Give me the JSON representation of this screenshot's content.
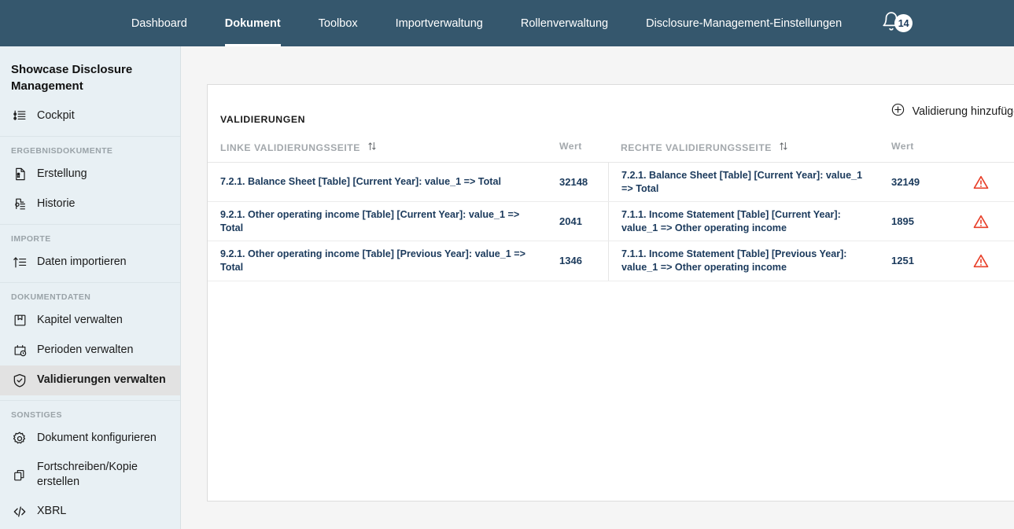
{
  "topnav": {
    "items": [
      {
        "label": "Dashboard",
        "active": false
      },
      {
        "label": "Dokument",
        "active": true
      },
      {
        "label": "Toolbox",
        "active": false
      },
      {
        "label": "Importverwaltung",
        "active": false
      },
      {
        "label": "Rollenverwaltung",
        "active": false
      },
      {
        "label": "Disclosure-Management-Einstellungen",
        "active": false
      }
    ],
    "notification_icon": "bell-icon",
    "notification_count": "14",
    "background_color": "#35576d"
  },
  "sidebar": {
    "brand": "Showcase Disclosure Management",
    "background_color": "#e8f0f4",
    "active_item_color": "#e2e2e2",
    "sections": [
      {
        "label": "",
        "items": [
          {
            "label": "Cockpit",
            "icon": "list-tree-icon",
            "active": false
          }
        ]
      },
      {
        "label": "ERGEBNISDOKUMENTE",
        "items": [
          {
            "label": "Erstellung",
            "icon": "document-badge-icon",
            "active": false
          },
          {
            "label": "Historie",
            "icon": "document-history-icon",
            "active": false
          }
        ]
      },
      {
        "label": "IMPORTE",
        "items": [
          {
            "label": "Daten importieren",
            "icon": "import-arrow-icon",
            "active": false
          }
        ]
      },
      {
        "label": "DOKUMENTDATEN",
        "items": [
          {
            "label": "Kapitel verwalten",
            "icon": "book-bookmark-icon",
            "active": false
          },
          {
            "label": "Perioden verwalten",
            "icon": "calendar-clock-icon",
            "active": false
          },
          {
            "label": "Validierungen verwalten",
            "icon": "shield-check-icon",
            "active": true
          }
        ]
      },
      {
        "label": "SONSTIGES",
        "items": [
          {
            "label": "Dokument konfigurieren",
            "icon": "gear-icon",
            "active": false
          },
          {
            "label": "Fortschreiben/Kopie erstellen",
            "icon": "copy-icon",
            "active": false
          },
          {
            "label": "XBRL",
            "icon": "code-brackets-icon",
            "active": false
          }
        ]
      }
    ]
  },
  "main": {
    "add_button": {
      "label": "Validierung hinzufügen",
      "icon": "circle-plus-icon"
    },
    "card_title": "VALIDIERUNGEN",
    "table": {
      "headers": {
        "left_page": "LINKE VALIDIERUNGSSEITE",
        "left_value": "Wert",
        "right_page": "RECHTE VALIDIERUNGSSEITE",
        "right_value": "Wert",
        "sort_icon": "sort-updown-icon"
      },
      "row_status_icon": "warning-triangle-icon",
      "row_status_color": "#e8402a",
      "row_menu_icon": "kebab-menu-icon",
      "rows": [
        {
          "left_page": "7.2.1. Balance Sheet [Table] [Current Year]: value_1 => Total",
          "left_value": "32148",
          "right_page": "7.2.1. Balance Sheet [Table] [Current Year]: value_1 => Total",
          "right_value": "32149"
        },
        {
          "left_page": "9.2.1. Other operating income [Table] [Current Year]: value_1 => Total",
          "left_value": "2041",
          "right_page": "7.1.1. Income Statement [Table] [Current Year]: value_1 => Other operating income",
          "right_value": "1895"
        },
        {
          "left_page": "9.2.1. Other operating income [Table] [Previous Year]: value_1 => Total",
          "left_value": "1346",
          "right_page": "7.1.1. Income Statement [Table] [Previous Year]: value_1 => Other operating income",
          "right_value": "1251"
        }
      ]
    }
  }
}
